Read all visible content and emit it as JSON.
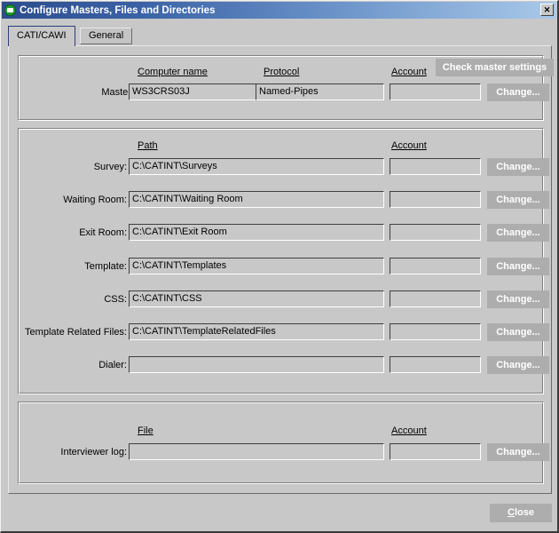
{
  "window": {
    "title": "Configure Masters, Files and Directories",
    "icon": "app-window-icon",
    "close_glyph": "✕"
  },
  "tabs": [
    {
      "label": "CATI/CAWI",
      "active": true
    },
    {
      "label": "General",
      "active": false
    }
  ],
  "master_section": {
    "headers": {
      "computer_name": "Computer name",
      "protocol": "Protocol",
      "account": "Account"
    },
    "check_button": "Check master settings",
    "row": {
      "label": "Master:",
      "computer_name": "WS3CRS03J",
      "protocol": "Named-Pipes",
      "account": "",
      "change_button": "Change..."
    }
  },
  "paths_section": {
    "headers": {
      "path": "Path",
      "account": "Account"
    },
    "rows": [
      {
        "label": "Survey:",
        "path": "C:\\CATINT\\Surveys",
        "account": "",
        "change_button": "Change..."
      },
      {
        "label": "Waiting Room:",
        "path": "C:\\CATINT\\Waiting Room",
        "account": "",
        "change_button": "Change..."
      },
      {
        "label": "Exit Room:",
        "path": "C:\\CATINT\\Exit Room",
        "account": "",
        "change_button": "Change..."
      },
      {
        "label": "Template:",
        "path": "C:\\CATINT\\Templates",
        "account": "",
        "change_button": "Change..."
      },
      {
        "label": "CSS:",
        "path": "C:\\CATINT\\CSS",
        "account": "",
        "change_button": "Change..."
      },
      {
        "label": "Template Related Files:",
        "path": "C:\\CATINT\\TemplateRelatedFiles",
        "account": "",
        "change_button": "Change..."
      },
      {
        "label": "Dialer:",
        "path": "",
        "account": "",
        "change_button": "Change..."
      }
    ]
  },
  "log_section": {
    "headers": {
      "file": "File",
      "account": "Account"
    },
    "row": {
      "label": "Interviewer log:",
      "file": "",
      "account": "",
      "change_button": "Change..."
    }
  },
  "footer": {
    "close_button_prefix": "",
    "close_button_accel": "C",
    "close_button_suffix": "lose",
    "close_button_label": "Close"
  },
  "colors": {
    "face": "#c8c8c8",
    "title_left": "#2c4d8e",
    "title_right": "#a9c9e9",
    "button_face": "#adadad",
    "button_text": "#ffffff",
    "active_tab_border": "#2b3f7a"
  }
}
